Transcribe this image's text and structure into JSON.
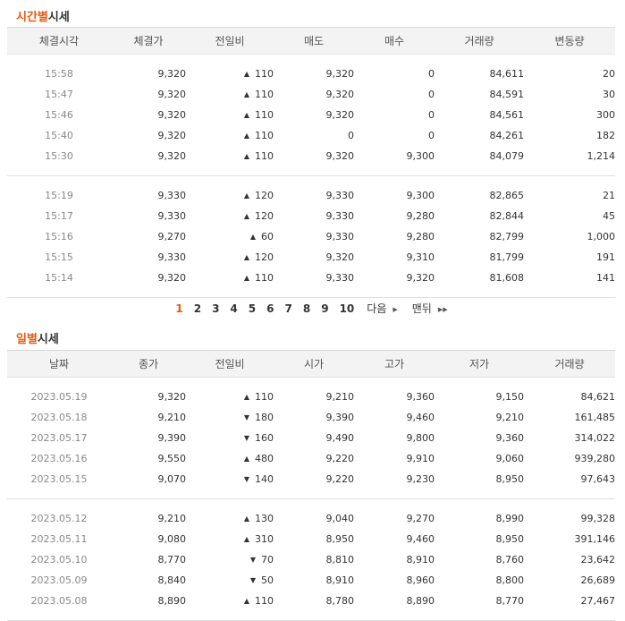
{
  "time_section": {
    "title_accent": "시간별",
    "title_rest": "시세",
    "headers": [
      "체결시각",
      "체결가",
      "전일비",
      "매도",
      "매수",
      "거래량",
      "변동량"
    ],
    "groups": [
      [
        {
          "time": "15:58",
          "price": "9,320",
          "dir": "up",
          "change": "110",
          "sell": "9,320",
          "buy": "0",
          "volume": "84,611",
          "delta": "20"
        },
        {
          "time": "15:47",
          "price": "9,320",
          "dir": "up",
          "change": "110",
          "sell": "9,320",
          "buy": "0",
          "volume": "84,591",
          "delta": "30"
        },
        {
          "time": "15:46",
          "price": "9,320",
          "dir": "up",
          "change": "110",
          "sell": "9,320",
          "buy": "0",
          "volume": "84,561",
          "delta": "300"
        },
        {
          "time": "15:40",
          "price": "9,320",
          "dir": "up",
          "change": "110",
          "sell": "0",
          "buy": "0",
          "volume": "84,261",
          "delta": "182"
        },
        {
          "time": "15:30",
          "price": "9,320",
          "dir": "up",
          "change": "110",
          "sell": "9,320",
          "buy": "9,300",
          "volume": "84,079",
          "delta": "1,214"
        }
      ],
      [
        {
          "time": "15:19",
          "price": "9,330",
          "dir": "up",
          "change": "120",
          "sell": "9,330",
          "buy": "9,300",
          "volume": "82,865",
          "delta": "21"
        },
        {
          "time": "15:17",
          "price": "9,330",
          "dir": "up",
          "change": "120",
          "sell": "9,330",
          "buy": "9,280",
          "volume": "82,844",
          "delta": "45"
        },
        {
          "time": "15:16",
          "price": "9,270",
          "dir": "up",
          "change": "60",
          "sell": "9,330",
          "buy": "9,280",
          "volume": "82,799",
          "delta": "1,000"
        },
        {
          "time": "15:15",
          "price": "9,330",
          "dir": "up",
          "change": "120",
          "sell": "9,320",
          "buy": "9,310",
          "volume": "81,799",
          "delta": "191"
        },
        {
          "time": "15:14",
          "price": "9,320",
          "dir": "up",
          "change": "110",
          "sell": "9,330",
          "buy": "9,320",
          "volume": "81,608",
          "delta": "141"
        }
      ]
    ]
  },
  "pagination": {
    "pages": [
      "1",
      "2",
      "3",
      "4",
      "5",
      "6",
      "7",
      "8",
      "9",
      "10"
    ],
    "current": "1",
    "next_label": "다음",
    "last_label": "맨뒤"
  },
  "daily_section": {
    "title_accent": "일별",
    "title_rest": "시세",
    "headers": [
      "날짜",
      "종가",
      "전일비",
      "시가",
      "고가",
      "저가",
      "거래량"
    ],
    "groups": [
      [
        {
          "date": "2023.05.19",
          "close": "9,320",
          "dir": "up",
          "change": "110",
          "open": "9,210",
          "high": "9,360",
          "low": "9,150",
          "volume": "84,621"
        },
        {
          "date": "2023.05.18",
          "close": "9,210",
          "dir": "down",
          "change": "180",
          "open": "9,390",
          "high": "9,460",
          "low": "9,210",
          "volume": "161,485"
        },
        {
          "date": "2023.05.17",
          "close": "9,390",
          "dir": "down",
          "change": "160",
          "open": "9,490",
          "high": "9,800",
          "low": "9,360",
          "volume": "314,022"
        },
        {
          "date": "2023.05.16",
          "close": "9,550",
          "dir": "up",
          "change": "480",
          "open": "9,220",
          "high": "9,910",
          "low": "9,060",
          "volume": "939,280"
        },
        {
          "date": "2023.05.15",
          "close": "9,070",
          "dir": "down",
          "change": "140",
          "open": "9,220",
          "high": "9,230",
          "low": "8,950",
          "volume": "97,643"
        }
      ],
      [
        {
          "date": "2023.05.12",
          "close": "9,210",
          "dir": "up",
          "change": "130",
          "open": "9,040",
          "high": "9,270",
          "low": "8,990",
          "volume": "99,328"
        },
        {
          "date": "2023.05.11",
          "close": "9,080",
          "dir": "up",
          "change": "310",
          "open": "8,950",
          "high": "9,460",
          "low": "8,950",
          "volume": "391,146"
        },
        {
          "date": "2023.05.10",
          "close": "8,770",
          "dir": "down",
          "change": "70",
          "open": "8,810",
          "high": "8,910",
          "low": "8,760",
          "volume": "23,642"
        },
        {
          "date": "2023.05.09",
          "close": "8,840",
          "dir": "down",
          "change": "50",
          "open": "8,910",
          "high": "8,960",
          "low": "8,800",
          "volume": "26,689"
        },
        {
          "date": "2023.05.08",
          "close": "8,890",
          "dir": "up",
          "change": "110",
          "open": "8,780",
          "high": "8,890",
          "low": "8,770",
          "volume": "27,467"
        }
      ]
    ]
  },
  "icons": {
    "up": "triangle-up-icon",
    "down": "triangle-down-icon"
  },
  "colors": {
    "accent": "#e8590c",
    "up": "#d40000",
    "down": "#1f5fbf"
  }
}
